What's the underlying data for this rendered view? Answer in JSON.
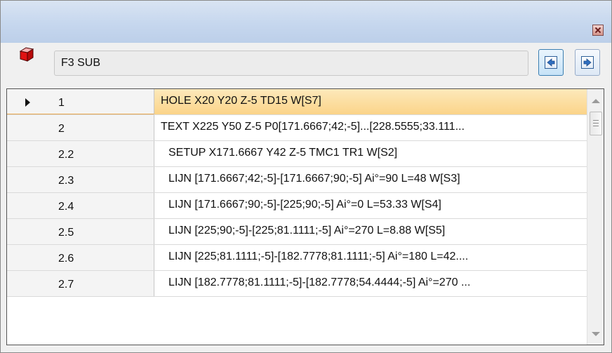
{
  "toolbar": {
    "field_value": "F3 SUB",
    "prev_icon": "arrow-left-icon",
    "next_icon": "arrow-right-icon",
    "object_icon": "cube-icon"
  },
  "rows": [
    {
      "num": "1",
      "cmd": "HOLE X20 Y20 Z-5 TD15 W[S7]",
      "selected": true
    },
    {
      "num": "2",
      "cmd": "TEXT X225 Y50 Z-5 P0[171.6667;42;-5]...[228.5555;33.111...",
      "selected": false
    },
    {
      "num": "2.2",
      "cmd": " SETUP X171.6667 Y42 Z-5 TMC1 TR1 W[S2]",
      "selected": false
    },
    {
      "num": "2.3",
      "cmd": " LIJN [171.6667;42;-5]-[171.6667;90;-5] Ai°=90 L=48 W[S3]",
      "selected": false
    },
    {
      "num": "2.4",
      "cmd": " LIJN [171.6667;90;-5]-[225;90;-5] Ai°=0 L=53.33 W[S4]",
      "selected": false
    },
    {
      "num": "2.5",
      "cmd": " LIJN [225;90;-5]-[225;81.1111;-5] Ai°=270 L=8.88 W[S5]",
      "selected": false
    },
    {
      "num": "2.6",
      "cmd": " LIJN [225;81.1111;-5]-[182.7778;81.1111;-5] Ai°=180 L=42....",
      "selected": false
    },
    {
      "num": "2.7",
      "cmd": " LIJN [182.7778;81.1111;-5]-[182.7778;54.4444;-5] Ai°=270 ...",
      "selected": false
    }
  ],
  "colors": {
    "selected_row": "#fbd489",
    "titlebar": "#c6d7ee"
  }
}
